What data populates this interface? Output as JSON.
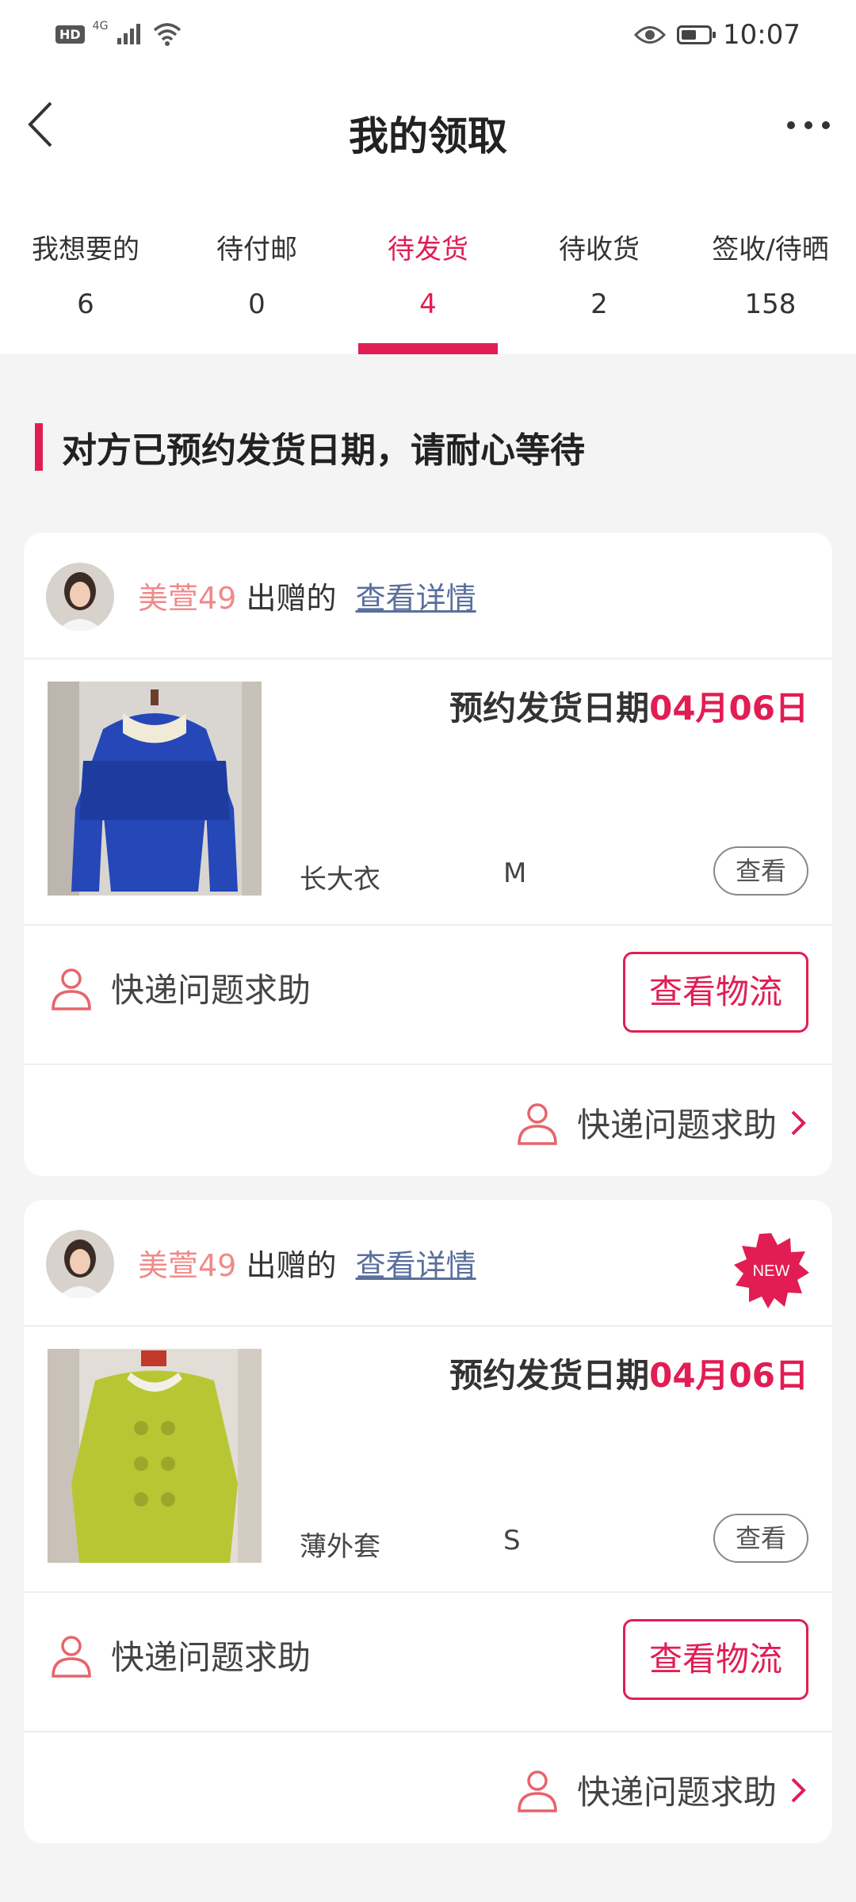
{
  "status_bar": {
    "hd": "HD",
    "network": "4G",
    "time": "10:07",
    "battery_level": 0.55
  },
  "nav": {
    "title": "我的领取"
  },
  "tabs": [
    {
      "label": "我想要的",
      "count": "6"
    },
    {
      "label": "待付邮",
      "count": "0"
    },
    {
      "label": "待发货",
      "count": "4",
      "active": true
    },
    {
      "label": "待收货",
      "count": "2"
    },
    {
      "label": "签收/待晒",
      "count": "158"
    }
  ],
  "notice": "对方已预约发货日期，请耐心等待",
  "cards": [
    {
      "giver": "美萱49",
      "gave_text": "出赠的",
      "detail_link": "查看详情",
      "new": false,
      "ship_label": "预约发货日期",
      "ship_date": "04月06日",
      "item_name": "长大衣",
      "item_size": "M",
      "view_label": "查看",
      "help_label": "快递问题求助",
      "logistics_label": "查看物流",
      "footer_help_label": "快递问题求助"
    },
    {
      "giver": "美萱49",
      "gave_text": "出赠的",
      "detail_link": "查看详情",
      "new": true,
      "new_label": "NEW",
      "ship_label": "预约发货日期",
      "ship_date": "04月06日",
      "item_name": "薄外套",
      "item_size": "S",
      "view_label": "查看",
      "help_label": "快递问题求助",
      "logistics_label": "查看物流",
      "footer_help_label": "快递问题求助"
    }
  ],
  "colors": {
    "accent": "#e11d54",
    "link": "#5a6f9c",
    "giver": "#f08a8a"
  },
  "icons": [
    "back-arrow-icon",
    "more-dots-icon",
    "person-icon",
    "chevron-right-icon",
    "new-badge-icon",
    "eye-icon",
    "wifi-icon",
    "signal-icon",
    "battery-icon"
  ]
}
